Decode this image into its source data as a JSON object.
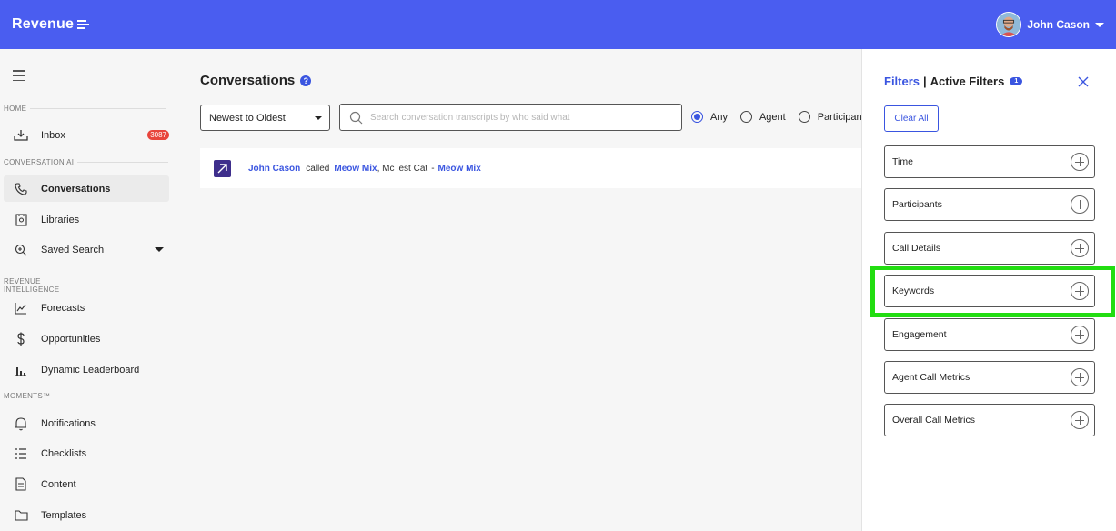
{
  "header": {
    "brand": "Revenue",
    "user_name": "John Cason"
  },
  "sidebar": {
    "sections": {
      "home": "HOME",
      "conversation_ai": "CONVERSATION AI",
      "revenue_intelligence": "REVENUE INTELLIGENCE",
      "moments": "MOMENTS™"
    },
    "items": [
      {
        "label": "Inbox",
        "badge": "3087"
      },
      {
        "label": "Conversations"
      },
      {
        "label": "Libraries"
      },
      {
        "label": "Saved Search"
      },
      {
        "label": "Forecasts"
      },
      {
        "label": "Opportunities"
      },
      {
        "label": "Dynamic Leaderboard"
      },
      {
        "label": "Notifications"
      },
      {
        "label": "Checklists"
      },
      {
        "label": "Content"
      },
      {
        "label": "Templates"
      }
    ]
  },
  "main": {
    "title": "Conversations",
    "help_symbol": "?",
    "sort_value": "Newest to Oldest",
    "search_placeholder": "Search conversation transcripts by who said what",
    "radios": [
      {
        "label": "Any",
        "selected": true
      },
      {
        "label": "Agent",
        "selected": false
      },
      {
        "label": "Participant",
        "selected": false
      }
    ],
    "conversation": {
      "caller": "John Cason",
      "verb": "called",
      "callee": "Meow Mix",
      "others": ", McTest Cat",
      "dash": "-",
      "account": "Meow Mix"
    }
  },
  "filters": {
    "title": "Filters",
    "separator": "|",
    "active_label": "Active Filters",
    "active_count": "1",
    "clear_label": "Clear All",
    "items": [
      "Time",
      "Participants",
      "Call Details",
      "Keywords",
      "Engagement",
      "Agent Call Metrics",
      "Overall Call Metrics"
    ]
  },
  "colors": {
    "brand": "#4a5df0",
    "link": "#3a55e0",
    "highlight": "#22dd11",
    "badge": "#e8453c"
  }
}
